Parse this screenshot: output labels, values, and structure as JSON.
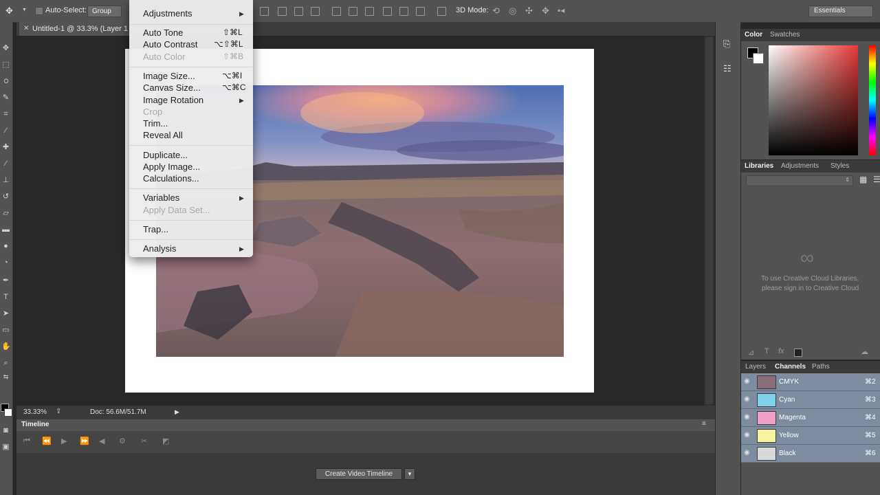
{
  "options_bar": {
    "auto_select_label": "Auto-Select:",
    "auto_select_value": "Group",
    "mode_3d_label": "3D Mode:",
    "workspace": "Essentials"
  },
  "document": {
    "tab_title": "Untitled-1 @ 33.3% (Layer 1"
  },
  "status": {
    "zoom": "33.33%",
    "doc_size": "Doc: 56.6M/51.7M"
  },
  "timeline": {
    "title": "Timeline",
    "create_button": "Create Video Timeline"
  },
  "image_menu": {
    "items": [
      {
        "label": "Adjustments",
        "shortcut": "",
        "submenu": true,
        "disabled": false
      },
      {
        "label": "Auto Tone",
        "shortcut": "⇧⌘L",
        "submenu": false,
        "disabled": false
      },
      {
        "label": "Auto Contrast",
        "shortcut": "⌥⇧⌘L",
        "submenu": false,
        "disabled": false
      },
      {
        "label": "Auto Color",
        "shortcut": "⇧⌘B",
        "submenu": false,
        "disabled": true
      },
      {
        "label": "Image Size...",
        "shortcut": "⌥⌘I",
        "submenu": false,
        "disabled": false
      },
      {
        "label": "Canvas Size...",
        "shortcut": "⌥⌘C",
        "submenu": false,
        "disabled": false
      },
      {
        "label": "Image Rotation",
        "shortcut": "",
        "submenu": true,
        "disabled": false
      },
      {
        "label": "Crop",
        "shortcut": "",
        "submenu": false,
        "disabled": true
      },
      {
        "label": "Trim...",
        "shortcut": "",
        "submenu": false,
        "disabled": false
      },
      {
        "label": "Reveal All",
        "shortcut": "",
        "submenu": false,
        "disabled": false
      },
      {
        "label": "Duplicate...",
        "shortcut": "",
        "submenu": false,
        "disabled": false
      },
      {
        "label": "Apply Image...",
        "shortcut": "",
        "submenu": false,
        "disabled": false
      },
      {
        "label": "Calculations...",
        "shortcut": "",
        "submenu": false,
        "disabled": false
      },
      {
        "label": "Variables",
        "shortcut": "",
        "submenu": true,
        "disabled": false
      },
      {
        "label": "Apply Data Set...",
        "shortcut": "",
        "submenu": false,
        "disabled": true
      },
      {
        "label": "Trap...",
        "shortcut": "",
        "submenu": false,
        "disabled": false
      },
      {
        "label": "Analysis",
        "shortcut": "",
        "submenu": true,
        "disabled": false
      }
    ]
  },
  "color_panel": {
    "tabs": [
      "Color",
      "Swatches"
    ]
  },
  "libraries_panel": {
    "tabs": [
      "Libraries",
      "Adjustments",
      "Styles"
    ],
    "message_line1": "To use Creative Cloud Libraries,",
    "message_line2": "please sign in to Creative Cloud"
  },
  "channels_panel": {
    "tabs": [
      "Layers",
      "Channels",
      "Paths"
    ],
    "rows": [
      {
        "name": "CMYK",
        "shortcut": "⌘2",
        "thumb": "#8a6f7a"
      },
      {
        "name": "Cyan",
        "shortcut": "⌘3",
        "thumb": "#7fd0ec"
      },
      {
        "name": "Magenta",
        "shortcut": "⌘4",
        "thumb": "#f0a0c8"
      },
      {
        "name": "Yellow",
        "shortcut": "⌘5",
        "thumb": "#f7f3a0"
      },
      {
        "name": "Black",
        "shortcut": "⌘6",
        "thumb": "#d8d8d8"
      }
    ]
  },
  "colors": {
    "ui_dark": "#282828",
    "ui_panel": "#535353",
    "channel_highlight": "#7d8c9e"
  }
}
